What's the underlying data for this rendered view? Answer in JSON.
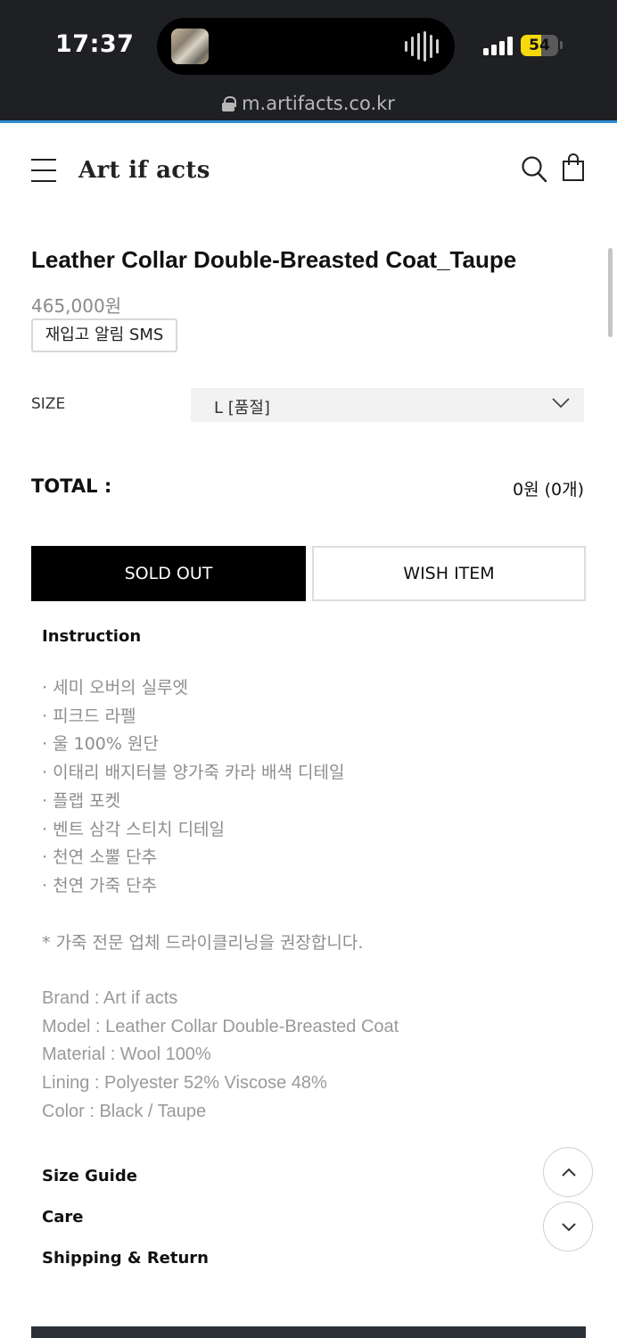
{
  "status_bar": {
    "time": "17:37",
    "battery_percent": 54,
    "battery_label": "54",
    "signal_bars": 4
  },
  "browser": {
    "url": "m.artifacts.co.kr"
  },
  "header": {
    "logo": "Art if acts",
    "icons": [
      "menu-icon",
      "search-icon",
      "shopping-bag-icon"
    ]
  },
  "product": {
    "title": "Leather Collar Double-Breasted Coat_Taupe",
    "price": "465,000원",
    "restock_button": "재입고 알림 SMS",
    "size_label": "SIZE",
    "size_selected": "L [품절]",
    "total_label": "TOTAL :",
    "total_value": "0원 (0개)",
    "sold_out_button": "SOLD OUT",
    "wish_button": "WISH ITEM"
  },
  "instruction": {
    "heading": "Instruction",
    "features": [
      "세미 오버의 실루엣",
      "피크드 라펠",
      "울 100% 원단",
      "이태리 배지터블 양가죽 카라 배색 디테일",
      "플랩 포켓",
      "벤트 삼각 스티치 디테일",
      "천연 소뿔 단추",
      "천연 가죽 단추"
    ],
    "note": "* 가죽 전문 업체 드라이클리닝을 권장합니다.",
    "specs": [
      "Brand : Art if acts",
      "Model : Leather Collar Double-Breasted Coat",
      "Material : Wool 100%",
      "Lining : Polyester 52% Viscose 48%",
      "Color : Black / Taupe"
    ]
  },
  "sections": {
    "size_guide": "Size Guide",
    "care": "Care",
    "shipping": "Shipping & Return"
  },
  "colors": {
    "status_bar_bg": "#1f2023",
    "url_accent": "#2f8fd6",
    "battery": "#f5d90a",
    "sold_out_bg": "#000000"
  }
}
